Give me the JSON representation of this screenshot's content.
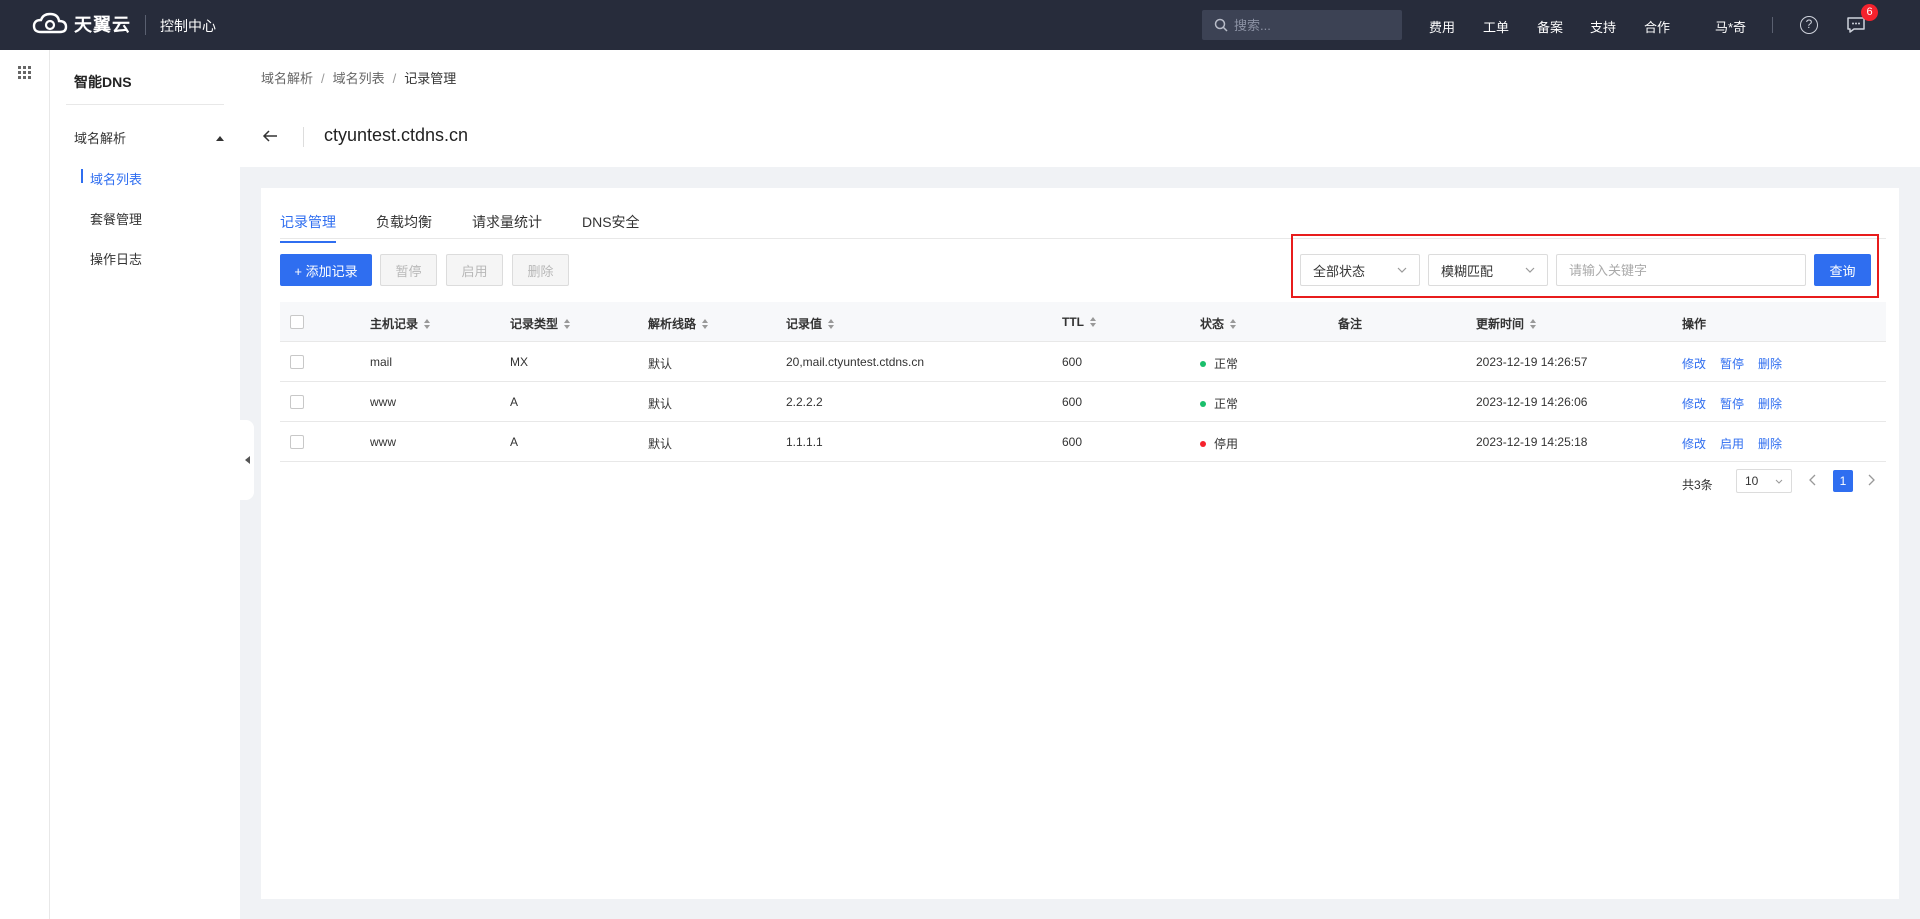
{
  "topbar": {
    "brand": "天翼云",
    "console": "控制中心",
    "search_placeholder": "搜索...",
    "nav": [
      "费用",
      "工单",
      "备案",
      "支持",
      "合作"
    ],
    "user": "马*奇",
    "help_glyph": "?",
    "notification_count": "6"
  },
  "sidebar": {
    "title": "智能DNS",
    "group": "域名解析",
    "items": [
      "域名列表",
      "套餐管理",
      "操作日志"
    ],
    "active_item": "域名列表"
  },
  "breadcrumb": {
    "items": [
      "域名解析",
      "域名列表",
      "记录管理"
    ],
    "separator": "/"
  },
  "page_title": "ctyuntest.ctdns.cn",
  "tabs": [
    "记录管理",
    "负载均衡",
    "请求量统计",
    "DNS安全"
  ],
  "active_tab": "记录管理",
  "toolbar": {
    "add_label": "+ 添加记录",
    "pause_label": "暂停",
    "enable_label": "启用",
    "delete_label": "删除"
  },
  "filters": {
    "status_value": "全部状态",
    "match_value": "模糊匹配",
    "keyword_placeholder": "请输入关键字",
    "query_label": "查询"
  },
  "table": {
    "headers": {
      "host": "主机记录",
      "type": "记录类型",
      "line": "解析线路",
      "value": "记录值",
      "ttl": "TTL",
      "status": "状态",
      "remark": "备注",
      "updated": "更新时间",
      "actions": "操作"
    },
    "rows": [
      {
        "host": "mail",
        "type": "MX",
        "line": "默认",
        "value": "20,mail.ctyuntest.ctdns.cn",
        "ttl": "600",
        "status": "正常",
        "status_color": "#19be6b",
        "updated": "2023-12-19 14:26:57",
        "actions": [
          "修改",
          "暂停",
          "删除"
        ]
      },
      {
        "host": "www",
        "type": "A",
        "line": "默认",
        "value": "2.2.2.2",
        "ttl": "600",
        "status": "正常",
        "status_color": "#19be6b",
        "updated": "2023-12-19 14:26:06",
        "actions": [
          "修改",
          "暂停",
          "删除"
        ]
      },
      {
        "host": "www",
        "type": "A",
        "line": "默认",
        "value": "1.1.1.1",
        "ttl": "600",
        "status": "停用",
        "status_color": "#f5222d",
        "updated": "2023-12-19 14:25:18",
        "actions": [
          "修改",
          "启用",
          "删除"
        ]
      }
    ]
  },
  "pagination": {
    "total": "共3条",
    "page_size": "10",
    "current_page": "1"
  },
  "colors": {
    "primary": "#2f6ef0",
    "topbar_bg": "#272c3b",
    "highlight_border": "#e81c1c"
  }
}
